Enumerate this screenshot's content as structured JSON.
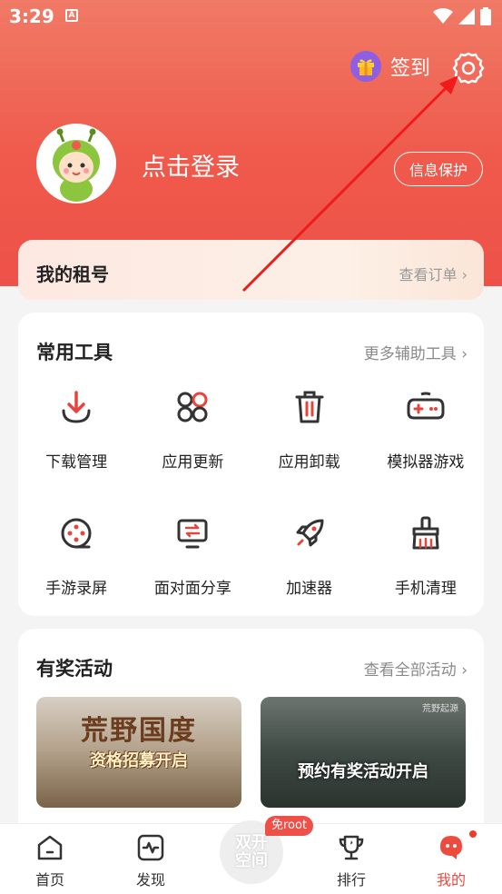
{
  "status_bar": {
    "time": "3:29",
    "notification": "A"
  },
  "header": {
    "sign_label": "签到",
    "login_text": "点击登录",
    "privacy_label": "信息保护"
  },
  "rent": {
    "title": "我的租号",
    "link": "查看订单 ›"
  },
  "tools": {
    "title": "常用工具",
    "more": "更多辅助工具 ›",
    "items": [
      {
        "label": "下载管理",
        "icon": "download-icon"
      },
      {
        "label": "应用更新",
        "icon": "app-update-icon"
      },
      {
        "label": "应用卸载",
        "icon": "trash-icon"
      },
      {
        "label": "模拟器游戏",
        "icon": "gamepad-icon"
      },
      {
        "label": "手游录屏",
        "icon": "record-icon"
      },
      {
        "label": "面对面分享",
        "icon": "share-icon"
      },
      {
        "label": "加速器",
        "icon": "rocket-icon"
      },
      {
        "label": "手机清理",
        "icon": "broom-icon"
      }
    ]
  },
  "activities": {
    "title": "有奖活动",
    "more": "查看全部活动 ›",
    "banners": [
      {
        "title": "荒野国度",
        "subtitle": "资格招募开启"
      },
      {
        "tag": "荒野起源",
        "subtitle": "预约有奖活动开启"
      }
    ]
  },
  "nav": {
    "items": [
      {
        "label": "首页",
        "icon": "home-icon"
      },
      {
        "label": "发现",
        "icon": "discover-icon"
      },
      {
        "label": "排行",
        "icon": "trophy-icon"
      },
      {
        "label": "我的",
        "icon": "profile-icon",
        "active": true
      }
    ],
    "center": {
      "line1": "双开",
      "line2": "空间",
      "badge": "免root"
    }
  },
  "colors": {
    "accent": "#ee4b3f",
    "header": "#ef5a4c",
    "gift": "#8e5fe0"
  }
}
